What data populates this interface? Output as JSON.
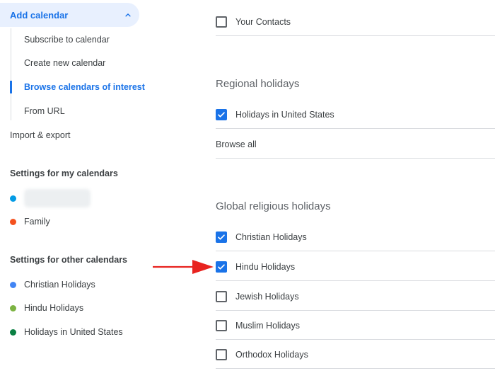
{
  "sidebar": {
    "add_calendar": "Add calendar",
    "sub_items": [
      "Subscribe to calendar",
      "Create new calendar",
      "Browse calendars of interest",
      "From URL"
    ],
    "import_export": "Import & export",
    "my_calendars_heading": "Settings for my calendars",
    "my_calendars": [
      {
        "name": "",
        "color": "#039be5"
      },
      {
        "name": "Family",
        "color": "#f4511e"
      }
    ],
    "other_calendars_heading": "Settings for other calendars",
    "other_calendars": [
      {
        "name": "Christian Holidays",
        "color": "#4285f4"
      },
      {
        "name": "Hindu Holidays",
        "color": "#7cb342"
      },
      {
        "name": "Holidays in United States",
        "color": "#0b8043"
      }
    ]
  },
  "main": {
    "your_contacts": {
      "label": "Your Contacts",
      "checked": false
    },
    "regional_title": "Regional holidays",
    "regional_items": [
      {
        "label": "Holidays in United States",
        "checked": true
      }
    ],
    "browse_all": "Browse all",
    "religious_title": "Global religious holidays",
    "religious_items": [
      {
        "label": "Christian Holidays",
        "checked": true
      },
      {
        "label": "Hindu Holidays",
        "checked": true
      },
      {
        "label": "Jewish Holidays",
        "checked": false
      },
      {
        "label": "Muslim Holidays",
        "checked": false
      },
      {
        "label": "Orthodox Holidays",
        "checked": false
      }
    ]
  },
  "colors": {
    "accent": "#1a73e8",
    "annotation_arrow": "#e8231f"
  }
}
